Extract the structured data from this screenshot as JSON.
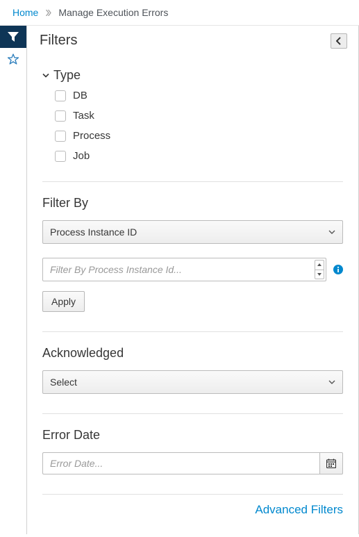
{
  "breadcrumb": {
    "home": "Home",
    "current": "Manage Execution Errors"
  },
  "panel": {
    "title": "Filters"
  },
  "type": {
    "header": "Type",
    "options": [
      "DB",
      "Task",
      "Process",
      "Job"
    ]
  },
  "filterBy": {
    "label": "Filter By",
    "selected": "Process Instance ID",
    "inputPlaceholder": "Filter By Process Instance Id...",
    "applyLabel": "Apply"
  },
  "acknowledged": {
    "label": "Acknowledged",
    "selected": "Select"
  },
  "errorDate": {
    "label": "Error Date",
    "placeholder": "Error Date..."
  },
  "advanced": {
    "label": "Advanced Filters"
  }
}
